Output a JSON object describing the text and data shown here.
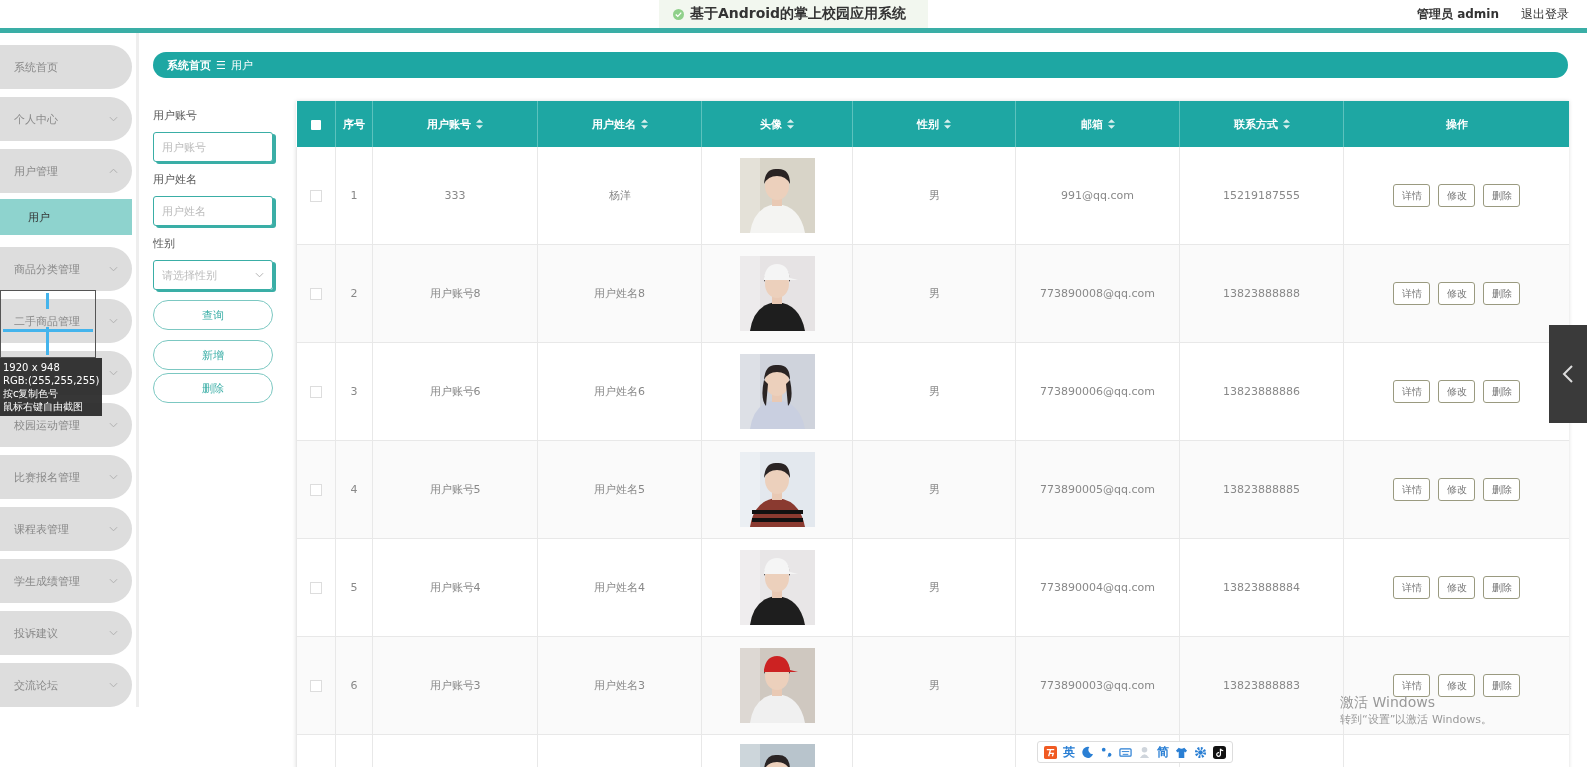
{
  "header": {
    "title": "基于Android的掌上校园应用系统",
    "user": "管理员 admin",
    "logout": "退出登录"
  },
  "sidebar": {
    "items": [
      {
        "label": "系统首页"
      },
      {
        "label": "个人中心",
        "expanded": false
      },
      {
        "label": "用户管理",
        "expanded": true,
        "children": [
          {
            "label": "用户",
            "selected": true
          }
        ]
      },
      {
        "label": "商品分类管理",
        "expanded": false
      },
      {
        "label": "二手商品管理",
        "expanded": false
      },
      {
        "expanded": false
      },
      {
        "label": "校园运动管理",
        "expanded": false
      },
      {
        "label": "比赛报名管理",
        "expanded": false
      },
      {
        "label": "课程表管理",
        "expanded": false
      },
      {
        "label": "学生成绩管理",
        "expanded": false
      },
      {
        "label": "投诉建议",
        "expanded": false
      },
      {
        "label": "交流论坛",
        "expanded": false
      }
    ]
  },
  "breadcrumb": {
    "home": "系统首页",
    "separator": "☰",
    "current": "用户"
  },
  "filters": [
    {
      "kind": "input",
      "label": "用户账号",
      "placeholder": "用户账号"
    },
    {
      "kind": "input",
      "label": "用户姓名",
      "placeholder": "用户姓名"
    },
    {
      "kind": "select",
      "label": "性别",
      "placeholder": "请选择性别"
    }
  ],
  "filter_buttons": [
    "查询",
    "新增",
    "删除"
  ],
  "table": {
    "columns": [
      {
        "kind": "check",
        "checked": false
      },
      {
        "label": "序号",
        "sortable": false
      },
      {
        "label": "用户账号",
        "sortable": true
      },
      {
        "label": "用户姓名",
        "sortable": true
      },
      {
        "label": "头像",
        "sortable": true
      },
      {
        "label": "性别",
        "sortable": true
      },
      {
        "label": "邮箱",
        "sortable": true
      },
      {
        "label": "联系方式",
        "sortable": true
      },
      {
        "label": "操作",
        "sortable": false
      }
    ],
    "rows": [
      {
        "checked": false,
        "index": "1",
        "account": "333",
        "name": "杨洋",
        "avatar": {
          "kind": "picture"
        },
        "gender": "男",
        "email": "991@qq.com",
        "phone": "15219187555",
        "actions": [
          "详情",
          "修改",
          "删除"
        ]
      },
      {
        "checked": false,
        "index": "2",
        "account": "用户账号8",
        "name": "用户姓名8",
        "avatar": {
          "kind": "picture"
        },
        "gender": "男",
        "email": "773890008@qq.com",
        "phone": "13823888888",
        "actions": [
          "详情",
          "修改",
          "删除"
        ]
      },
      {
        "checked": false,
        "index": "3",
        "account": "用户账号6",
        "name": "用户姓名6",
        "avatar": {
          "kind": "picture"
        },
        "gender": "男",
        "email": "773890006@qq.com",
        "phone": "13823888886",
        "actions": [
          "详情",
          "修改",
          "删除"
        ]
      },
      {
        "checked": false,
        "index": "4",
        "account": "用户账号5",
        "name": "用户姓名5",
        "avatar": {
          "kind": "picture"
        },
        "gender": "男",
        "email": "773890005@qq.com",
        "phone": "13823888885",
        "actions": [
          "详情",
          "修改",
          "删除"
        ]
      },
      {
        "checked": false,
        "index": "5",
        "account": "用户账号4",
        "name": "用户姓名4",
        "avatar": {
          "kind": "picture"
        },
        "gender": "男",
        "email": "773890004@qq.com",
        "phone": "13823888884",
        "actions": [
          "详情",
          "修改",
          "删除"
        ]
      },
      {
        "checked": false,
        "index": "6",
        "account": "用户账号3",
        "name": "用户姓名3",
        "avatar": {
          "kind": "picture"
        },
        "gender": "男",
        "email": "773890003@qq.com",
        "phone": "13823888883",
        "actions": [
          "详情",
          "修改",
          "删除"
        ]
      },
      {
        "avatar": {
          "kind": "picture"
        }
      }
    ]
  },
  "color_picker": {
    "lines": [
      "1920 x 948",
      "RGB:(255,255,255)",
      "按c复制色号",
      "鼠标右键自由截图"
    ]
  },
  "windows_notice": {
    "title": "激活 Windows",
    "text": "转到“设置”以激活 Windows。"
  },
  "ime_toolbar": {
    "items": [
      {
        "kind": "logo"
      },
      {
        "kind": "text",
        "label": "英"
      },
      {
        "kind": "moon"
      },
      {
        "kind": "dots"
      },
      {
        "kind": "keyboard"
      },
      {
        "kind": "person"
      },
      {
        "kind": "text",
        "label": "简"
      },
      {
        "kind": "shirt"
      },
      {
        "kind": "gear"
      },
      {
        "kind": "note"
      }
    ]
  }
}
